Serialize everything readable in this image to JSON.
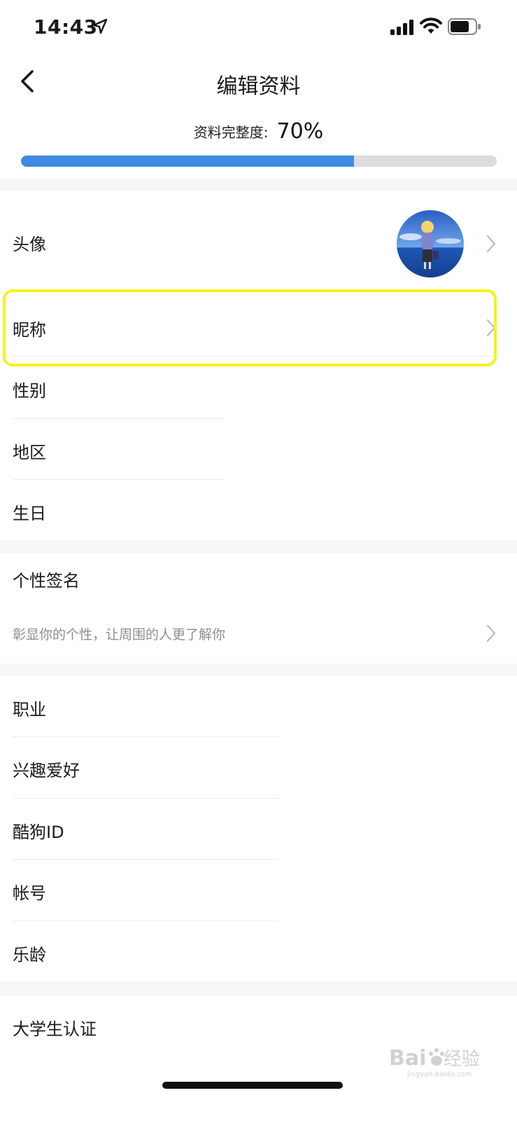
{
  "status_bar": {
    "time": "14:43"
  },
  "nav": {
    "title": "编辑资料"
  },
  "completeness": {
    "label": "资料完整度:",
    "value": "70%",
    "fraction": 0.7
  },
  "rows": {
    "avatar": "头像",
    "nickname": "昵称",
    "gender": "性别",
    "region": "地区",
    "birthday": "生日",
    "signature": "个性签名",
    "signature_hint": "彰显你的个性，让周围的人更了解你",
    "occupation": "职业",
    "hobbies": "兴趣爱好",
    "kugou_id": "酷狗ID",
    "account": "帐号",
    "music_age": "乐龄",
    "student_cert": "大学生认证"
  },
  "watermark": {
    "brand": "Baidu经验",
    "domain": "jingyan.baidu.com"
  },
  "colors": {
    "accent": "#3f8ae2",
    "highlight": "#f7f21c",
    "track": "#dcdcdc"
  }
}
